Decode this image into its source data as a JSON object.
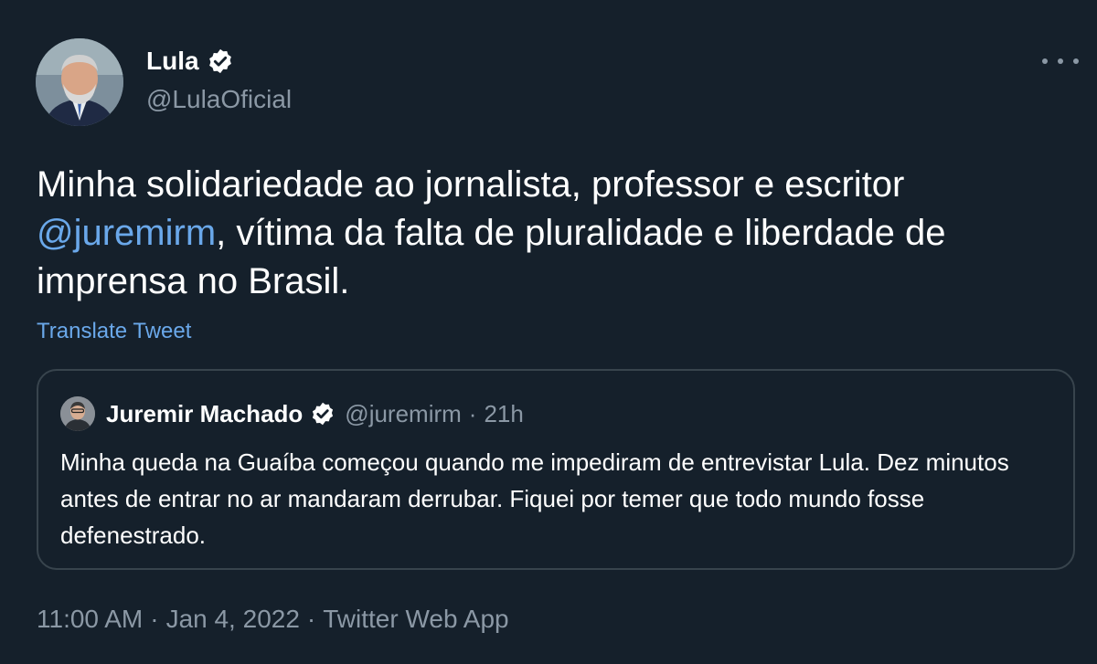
{
  "author": {
    "name": "Lula",
    "handle": "@LulaOficial",
    "verified_icon": "verified-badge-icon",
    "avatar_icon": "profile-photo"
  },
  "more_menu_icon": "more-options-icon",
  "tweet": {
    "text_before": "Minha solidariedade ao jornalista, professor e escritor ",
    "mention": "@juremirm",
    "text_after": ", vítima da falta de pluralidade e liberdade de imprensa no Brasil.",
    "translate_label": "Translate Tweet"
  },
  "quoted": {
    "name": "Juremir Machado",
    "handle": "@juremirm",
    "separator": "·",
    "time": "21h",
    "text": "Minha queda na Guaíba começou quando me impediram de entrevistar Lula. Dez minutos antes de entrar no ar mandaram derrubar. Fiquei por temer que todo mundo fosse defenestrado."
  },
  "meta": {
    "time": "11:00 AM",
    "date": "Jan 4, 2022",
    "client": "Twitter Web App",
    "separator": "·"
  },
  "colors": {
    "background": "#15202b",
    "link": "#6aa8ea",
    "secondary_text": "#8b98a5",
    "border": "#38444d"
  }
}
